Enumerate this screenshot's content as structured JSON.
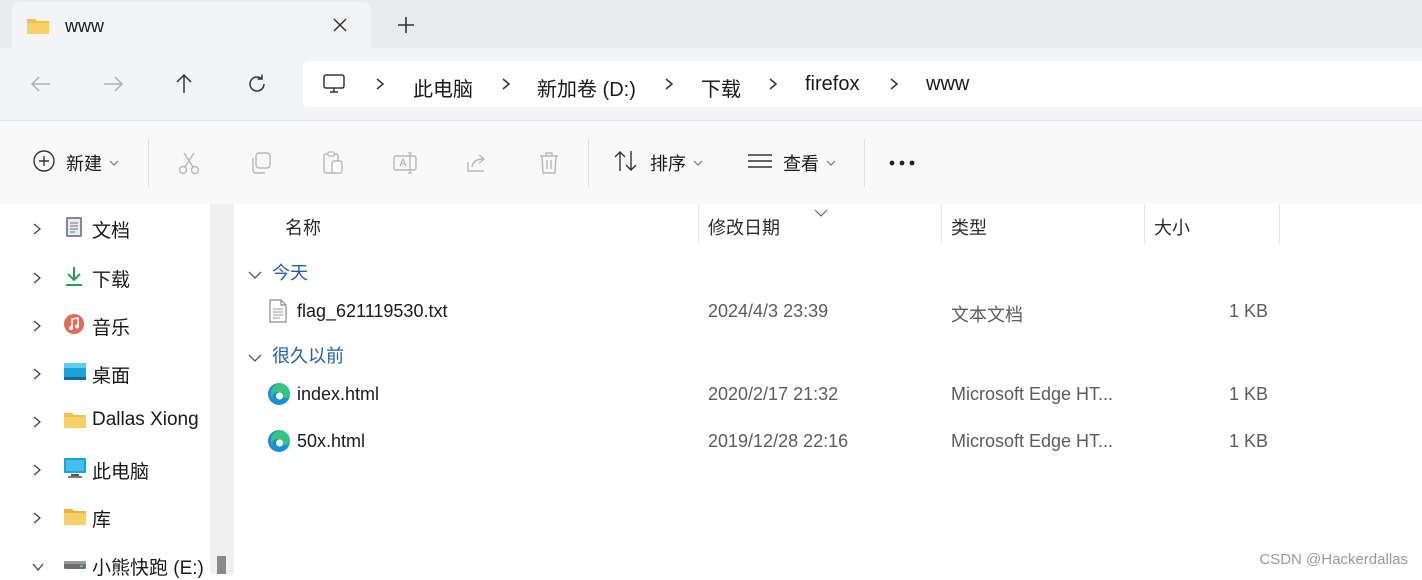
{
  "window": {
    "tab_title": "www",
    "new_tab_symbol": "+"
  },
  "address": {
    "crumbs": [
      "此电脑",
      "新加卷 (D:)",
      "下载",
      "firefox",
      "www"
    ]
  },
  "toolbar": {
    "new_label": "新建",
    "sort_label": "排序",
    "view_label": "查看",
    "more_label": "···"
  },
  "sidebar": {
    "items": [
      {
        "label": "文档",
        "icon": "document-icon",
        "expanded": false
      },
      {
        "label": "下载",
        "icon": "download-icon",
        "expanded": false
      },
      {
        "label": "音乐",
        "icon": "music-icon",
        "expanded": false
      },
      {
        "label": "桌面",
        "icon": "desktop-icon",
        "expanded": false
      },
      {
        "label": "Dallas Xiong",
        "icon": "folder-icon",
        "expanded": false
      },
      {
        "label": "此电脑",
        "icon": "this-pc-icon",
        "expanded": false
      },
      {
        "label": "库",
        "icon": "library-folder-icon",
        "expanded": false
      },
      {
        "label": "小熊快跑 (E:)",
        "icon": "drive-icon",
        "expanded": true
      }
    ]
  },
  "filelist": {
    "columns": {
      "name": "名称",
      "date": "修改日期",
      "type": "类型",
      "size": "大小"
    },
    "groups": [
      {
        "label": "今天",
        "files": [
          {
            "name": "flag_621119530.txt",
            "date": "2024/4/3 23:39",
            "type": "文本文档",
            "size": "1 KB",
            "icon": "text-file-icon"
          }
        ]
      },
      {
        "label": "很久以前",
        "files": [
          {
            "name": "index.html",
            "date": "2020/2/17 21:32",
            "type": "Microsoft Edge HT...",
            "size": "1 KB",
            "icon": "edge-html-icon"
          },
          {
            "name": "50x.html",
            "date": "2019/12/28 22:16",
            "type": "Microsoft Edge HT...",
            "size": "1 KB",
            "icon": "edge-html-icon"
          }
        ]
      }
    ]
  },
  "watermark": "CSDN @Hackerdallas",
  "colors": {
    "accent": "#1f5fa8",
    "folder": "#f5c04a",
    "edge": "#1b8fd6",
    "download": "#2a9d5c"
  }
}
